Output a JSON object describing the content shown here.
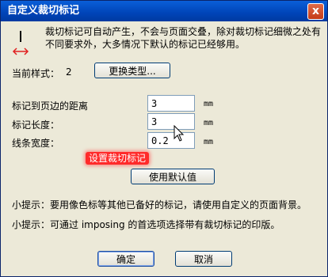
{
  "window": {
    "title": "自定义裁切标记",
    "close_label": "x"
  },
  "info": {
    "text": "裁切标记可自动产生，不会与页面交叠，除对裁切标记细微之处有不同要求外，大多情况下默认的标记已经够用。"
  },
  "style_row": {
    "label": "当前样式：",
    "value": "2",
    "change_button": "更换类型..."
  },
  "fields": [
    {
      "label": "标记到页边的距离",
      "value": "3",
      "unit": "mm"
    },
    {
      "label": "标记长度：",
      "value": "3",
      "unit": "mm"
    },
    {
      "label": "线条宽度：",
      "value": "0.2",
      "unit": "mm"
    }
  ],
  "tooltip": "设置裁切标记",
  "defaults_button": "使用默认值",
  "hints": [
    "小提示：要用像色标等其他已备好的标记，请使用自定义的页面背景。",
    "小提示：可通过 imposing 的首选项选择带有裁切标记的印版。"
  ],
  "buttons": {
    "ok": "确定",
    "cancel": "取消"
  },
  "colors": {
    "title_bar": "#0054e3",
    "dialog_bg": "#ece9d8",
    "tooltip_bg": "#ff2a2a",
    "icon_red": "#e02020"
  }
}
